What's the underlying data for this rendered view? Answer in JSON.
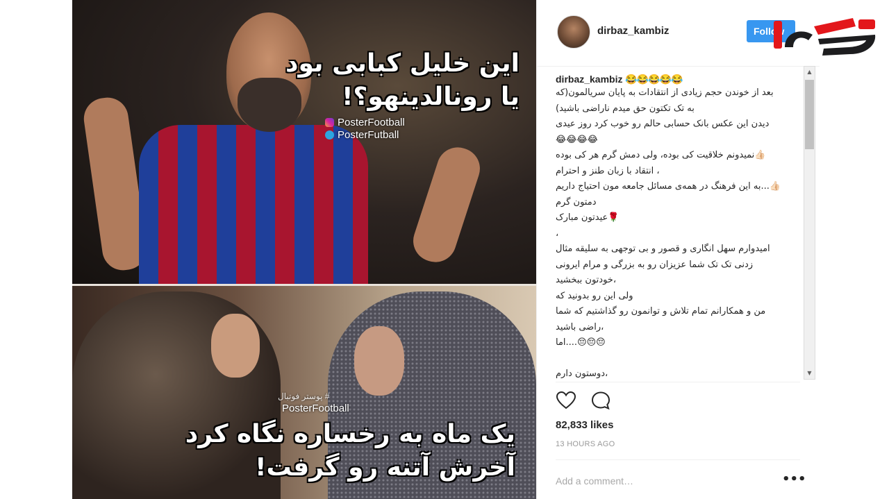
{
  "meme": {
    "caption_top_line1": "این خلیل کبابی بود",
    "caption_top_line2": "یا رونالدینهو؟!",
    "watermark_instagram": "PosterFootball",
    "watermark_telegram": "PosterFutball",
    "watermark_small_fa": "# پوستر فوتبال",
    "watermark_bottom": "PosterFootball",
    "caption_bottom_line1": "یک ماه به رخساره نگاه کرد",
    "caption_bottom_line2": "آخرش آتنه رو گرفت!"
  },
  "post": {
    "username": "dirbaz_kambiz",
    "follow_label": "Follow",
    "likes": "82,833 likes",
    "time_ago": "13 HOURS AGO",
    "add_comment_placeholder": "Add a comment…",
    "more_label": "•••"
  },
  "caption": {
    "username": "dirbaz_kambiz",
    "emoji": "😂😂😂😂😂",
    "lines": [
      "بعد از خوندن حجم زیادی از انتقادات به پایان سریالمون(که",
      "به تک تکتون حق میدم ناراضی باشید)",
      "دیدن این عکس بانک حسابی حالم رو خوب کرد روز عیدی",
      "😂😂😂😂",
      "👍🏻نمیدونم خلاقیت کی بوده، ولی دمش گرم هر کی بوده",
      "، انتقاد با زبان طنز و احترام",
      "👍🏻...به این فرهنگ در همه‌ی مسائل جامعه مون احتیاج داریم",
      "دمتون گرم",
      "🌹عیدتون مبارک",
      "،",
      "امیدوارم سهل انگاری و قصور و بی توجهی به سلیقه‌ مثال",
      "زدنی تک تک شما عزیزان رو به بزرگی و مرام ایرونی",
      "،خودتون ببخشید",
      "ولی این رو بدونید که",
      "من و همکارانم تمام تلاش و توانمون رو گذاشتیم که شما",
      "،راضی باشید",
      "😔😔😔....اما",
      "",
      "،دوستون دارم",
      "😂😂😂"
    ]
  },
  "colors": {
    "follow_button": "#3897f0",
    "logo_red": "#e3171b",
    "logo_dark": "#1d1d1f"
  },
  "icons": [
    "heart-icon",
    "comment-icon",
    "instagram-icon",
    "telegram-icon"
  ]
}
